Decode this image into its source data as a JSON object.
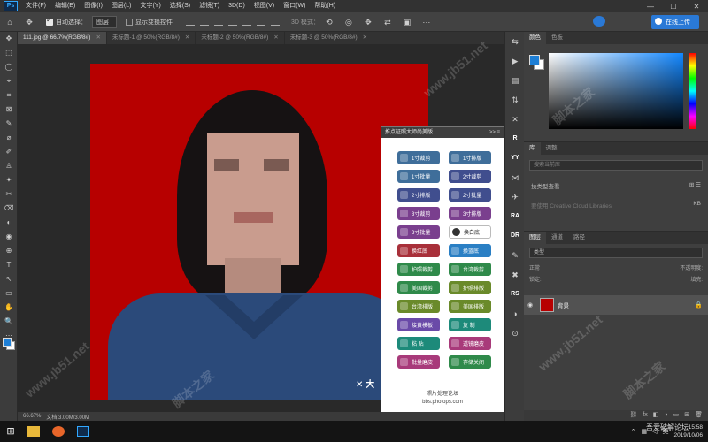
{
  "menu": {
    "logo": "Ps",
    "items": [
      "文件(F)",
      "编辑(E)",
      "图像(I)",
      "图层(L)",
      "文字(Y)",
      "选择(S)",
      "滤镜(T)",
      "3D(D)",
      "视图(V)",
      "窗口(W)",
      "帮助(H)"
    ],
    "window_controls": [
      "—",
      "☐",
      "✕"
    ]
  },
  "options": {
    "auto_select_label": "自动选择：",
    "auto_select_value": "图层",
    "show_transform_label": "显示变换控件",
    "mode_3d_label": "3D 模式：",
    "share_button": "在线上传"
  },
  "tabs": [
    {
      "label": "111.jpg @ 66.7%(RGB/8#)",
      "active": true
    },
    {
      "label": "未标题-1 @ 50%(RGB/8#)",
      "active": false
    },
    {
      "label": "未标题-2 @ 50%(RGB/8#)",
      "active": false
    },
    {
      "label": "未标题-3 @ 50%(RGB/8#)",
      "active": false
    }
  ],
  "tools": [
    "✥",
    "⬚",
    "◯",
    "⌖",
    "⌗",
    "⊠",
    "✎",
    "⌀",
    "✐",
    "♙",
    "✦",
    "✂",
    "⌫",
    "◐",
    "◉",
    "⊕",
    "T",
    "↖",
    "▭",
    "✋",
    "🔍",
    "⋯"
  ],
  "status": {
    "zoom": "66.67%",
    "doc": "文档:3.00M/3.00M"
  },
  "plugin": {
    "title": "推点证照大师尚美版",
    "header_controls": ">>  ≡",
    "buttons": [
      {
        "label": "1寸裁剪",
        "color": "#3f6e9a"
      },
      {
        "label": "1寸排版",
        "color": "#3f6e9a"
      },
      {
        "label": "1寸批量",
        "color": "#3f6e9a"
      },
      {
        "label": "2寸裁剪",
        "color": "#404e8e"
      },
      {
        "label": "2寸排版",
        "color": "#404e8e"
      },
      {
        "label": "2寸批量",
        "color": "#404e8e"
      },
      {
        "label": "3寸裁剪",
        "color": "#7a3f8e"
      },
      {
        "label": "3寸排版",
        "color": "#7a3f8e"
      },
      {
        "label": "3寸批量",
        "color": "#7a3f8e"
      },
      {
        "label": "换白底",
        "color": "outline"
      },
      {
        "label": "换红底",
        "color": "#a8303a"
      },
      {
        "label": "换蓝底",
        "color": "#2a7fc4"
      },
      {
        "label": "护照裁剪",
        "color": "#2f8a4a"
      },
      {
        "label": "台湾裁剪",
        "color": "#2f8a4a"
      },
      {
        "label": "美国裁剪",
        "color": "#2f8a4a"
      },
      {
        "label": "护照排版",
        "color": "#6a8a2a"
      },
      {
        "label": "台湾排版",
        "color": "#6a8a2a"
      },
      {
        "label": "美国排版",
        "color": "#6a8a2a"
      },
      {
        "label": "接黄模板",
        "color": "#6a4aa8"
      },
      {
        "label": "复 制",
        "color": "#1d8a7a"
      },
      {
        "label": "粘 贴",
        "color": "#1d8a7a"
      },
      {
        "label": "透镜磨皮",
        "color": "#a83a7a"
      },
      {
        "label": "批量磨皮",
        "color": "#a83a7a"
      },
      {
        "label": "存储关闭",
        "color": "#2f8a4a"
      }
    ],
    "footer_line1": "照片处理论坛",
    "footer_line2": "bbs.photops.com"
  },
  "mid_icons": [
    "⇆",
    "▶",
    "▤",
    "⇅",
    "✕",
    "R",
    "YY",
    "⋈",
    "✈",
    "RA",
    "DR",
    "✎",
    "✖",
    "RS",
    "◑",
    "⊙"
  ],
  "right": {
    "color_tabs": [
      "颜色",
      "色板"
    ],
    "adjust_tabs": [
      "库",
      "调整"
    ],
    "lib_search_placeholder": "搜索当前库",
    "lib_name": "扶类型查看",
    "lib_hint": "要使用 Creative Cloud Libraries",
    "lib_size": "KB",
    "layer_tabs": [
      "图层",
      "通道",
      "路径"
    ],
    "layer_filter": "类型",
    "blend_mode": "正常",
    "opacity_label": "不透明度:",
    "lock_label": "锁定:",
    "fill_label": "填充:",
    "layer_name": "背景"
  },
  "taskbar": {
    "time": "15:58",
    "date": "2019/10/06",
    "ime": "英",
    "brand": "吾爱破解论坛"
  },
  "watermarks": [
    "www.jb51.net",
    "脚本之家",
    "www.jb51.net",
    "脚本之家",
    "www.jb51.net",
    "脚本之家"
  ],
  "canvas_logo": "✕ 大"
}
